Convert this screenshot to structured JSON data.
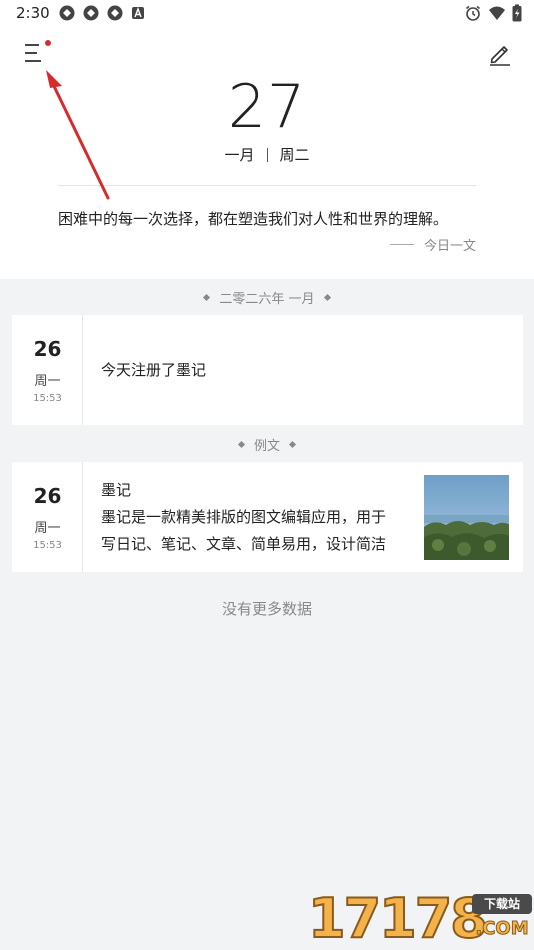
{
  "status_bar": {
    "time": "2:30",
    "left_icons": [
      "app-icon",
      "app-icon",
      "app-icon",
      "a-notification-icon"
    ],
    "right_icons": [
      "alarm-icon",
      "wifi-icon",
      "battery-icon"
    ]
  },
  "header": {
    "menu_icon": "menu-icon",
    "edit_icon": "edit-icon",
    "day": "27",
    "month": "一月",
    "weekday": "周二"
  },
  "daily_quote": {
    "text": "困难中的每一次选择，都在塑造我们对人性和世界的理解。",
    "source": "今日一文"
  },
  "sections": [
    {
      "title": "二零二六年 一月",
      "entries": [
        {
          "day": "26",
          "weekday": "周一",
          "time": "15:53",
          "text": "今天注册了墨记"
        }
      ]
    },
    {
      "title": "例文",
      "entries": [
        {
          "day": "26",
          "weekday": "周一",
          "time": "15:53",
          "title": "墨记",
          "lines": [
            "墨记是一款精美排版的图文编辑应用，用于",
            "写日记、笔记、文章、简单易用，设计简洁"
          ]
        }
      ]
    }
  ],
  "no_more": "没有更多数据",
  "watermark": {
    "number": "17178",
    "tag": "下载站",
    "suffix": ".COM"
  },
  "colors": {
    "accent_red": "#d0312d",
    "background": "#f2f3f5",
    "card": "#ffffff"
  }
}
